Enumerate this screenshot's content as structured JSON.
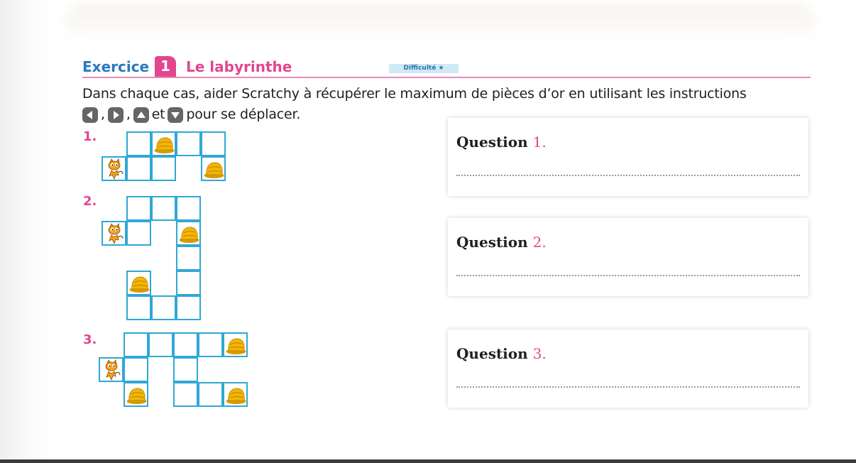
{
  "exercise": {
    "word": "Exercice",
    "number": "1",
    "title": "Le labyrinthe",
    "difficulty": "Difficulté ★"
  },
  "instruction": {
    "line1": "Dans chaque cas, aider Scratchy à récupérer le maximum de pièces d’or en utilisant les instructions",
    "sep1": ",",
    "sep2": ",",
    "et": "et",
    "line2_end": "pour se déplacer."
  },
  "arrow_keys": [
    "left-arrow-key",
    "right-arrow-key",
    "up-arrow-key",
    "down-arrow-key"
  ],
  "mazes": [
    {
      "label": "1.",
      "cells": [
        {
          "c": 1,
          "r": 0,
          "item": ""
        },
        {
          "c": 2,
          "r": 0,
          "item": "gold"
        },
        {
          "c": 3,
          "r": 0,
          "item": ""
        },
        {
          "c": 4,
          "r": 0,
          "item": ""
        },
        {
          "c": 0,
          "r": 1,
          "item": "cat"
        },
        {
          "c": 1,
          "r": 1,
          "item": ""
        },
        {
          "c": 2,
          "r": 1,
          "item": ""
        },
        {
          "c": 4,
          "r": 1,
          "item": "gold"
        }
      ]
    },
    {
      "label": "2.",
      "cells": [
        {
          "c": 1,
          "r": 0,
          "item": ""
        },
        {
          "c": 2,
          "r": 0,
          "item": ""
        },
        {
          "c": 3,
          "r": 0,
          "item": ""
        },
        {
          "c": 0,
          "r": 1,
          "item": "cat"
        },
        {
          "c": 1,
          "r": 1,
          "item": ""
        },
        {
          "c": 3,
          "r": 1,
          "item": "gold"
        },
        {
          "c": 3,
          "r": 2,
          "item": ""
        },
        {
          "c": 1,
          "r": 3,
          "item": "gold"
        },
        {
          "c": 3,
          "r": 3,
          "item": ""
        },
        {
          "c": 1,
          "r": 4,
          "item": ""
        },
        {
          "c": 2,
          "r": 4,
          "item": ""
        },
        {
          "c": 3,
          "r": 4,
          "item": ""
        }
      ]
    },
    {
      "label": "3.",
      "cells": [
        {
          "c": 1,
          "r": 0,
          "item": ""
        },
        {
          "c": 2,
          "r": 0,
          "item": ""
        },
        {
          "c": 3,
          "r": 0,
          "item": ""
        },
        {
          "c": 4,
          "r": 0,
          "item": ""
        },
        {
          "c": 5,
          "r": 0,
          "item": "gold"
        },
        {
          "c": 0,
          "r": 1,
          "item": "cat"
        },
        {
          "c": 1,
          "r": 1,
          "item": ""
        },
        {
          "c": 3,
          "r": 1,
          "item": ""
        },
        {
          "c": 1,
          "r": 2,
          "item": "gold"
        },
        {
          "c": 3,
          "r": 2,
          "item": ""
        },
        {
          "c": 4,
          "r": 2,
          "item": ""
        },
        {
          "c": 5,
          "r": 2,
          "item": "gold"
        }
      ]
    }
  ],
  "questions": [
    {
      "label": "Question",
      "number": "1."
    },
    {
      "label": "Question",
      "number": "2."
    },
    {
      "label": "Question",
      "number": "3."
    }
  ],
  "colors": {
    "title_blue": "#2b78c2",
    "accent_pink": "#e2468f",
    "grid_blue": "#2fa8d6",
    "gold": "#f2b705"
  }
}
